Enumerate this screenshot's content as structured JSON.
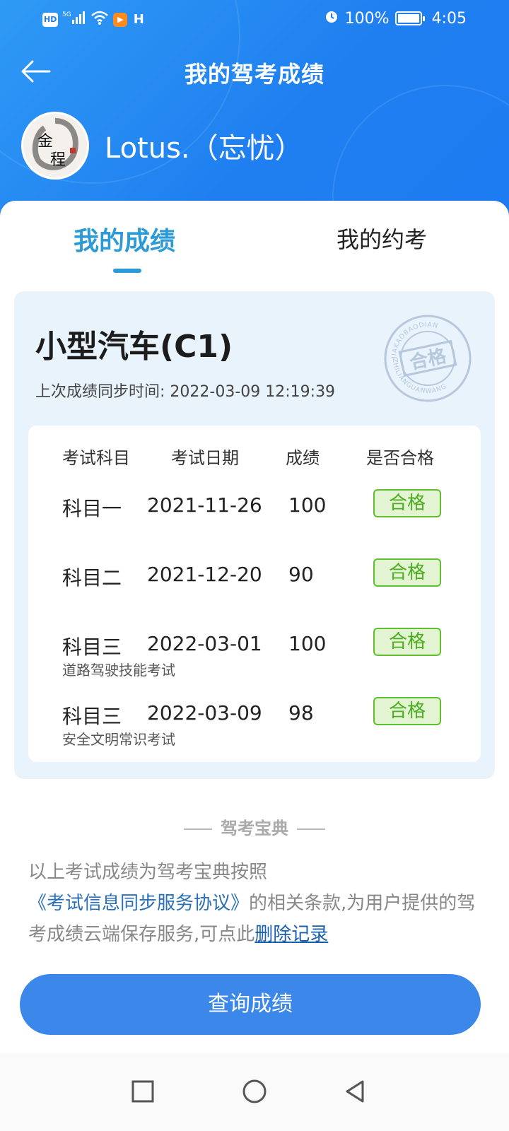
{
  "status_bar": {
    "chips": [
      "HD",
      "5G",
      "H"
    ],
    "battery_text": "100%",
    "battery_level": 1.0,
    "time": "4:05"
  },
  "header": {
    "title": "我的驾考成绩",
    "back_icon": "arrow-left-icon"
  },
  "profile": {
    "username": "Lotus.（忘忧）",
    "avatar_text": [
      "金",
      "程"
    ]
  },
  "tabs": [
    {
      "label": "我的成绩",
      "active": true
    },
    {
      "label": "我的约考",
      "active": false
    }
  ],
  "card": {
    "license": "小型汽车(C1)",
    "sync_line": "上次成绩同步时间: 2022-03-09 12:19:39",
    "stamp": {
      "main": "合格",
      "ring_top": "JIAKAOBAODIAN",
      "ring_bottom": "ZHILIANGUANWANG"
    }
  },
  "table": {
    "headers": [
      "考试科目",
      "考试日期",
      "成绩",
      "是否合格"
    ],
    "rows": [
      {
        "subject": "科目一",
        "date": "2021-11-26",
        "score": "100",
        "result": "合格",
        "note": ""
      },
      {
        "subject": "科目二",
        "date": "2021-12-20",
        "score": "90",
        "result": "合格",
        "note": ""
      },
      {
        "subject": "科目三",
        "date": "2022-03-01",
        "score": "100",
        "result": "合格",
        "note": "道路驾驶技能考试"
      },
      {
        "subject": "科目三",
        "date": "2022-03-09",
        "score": "98",
        "result": "合格",
        "note": "安全文明常识考试"
      }
    ]
  },
  "brand": "驾考宝典",
  "disclaimer": {
    "part1": "以上考试成绩为驾考宝典按照",
    "link": "《考试信息同步服务协议》",
    "part2": "的相关条款,为用户提供的驾考成绩云端保存服务,可点此",
    "delete_link": "删除记录"
  },
  "query_button": "查询成绩",
  "colors": {
    "header_blue": "#1f7ff0",
    "tab_active": "#2d9ad8",
    "pass_green": "#4cab1f",
    "button_blue": "#3c87ea"
  }
}
